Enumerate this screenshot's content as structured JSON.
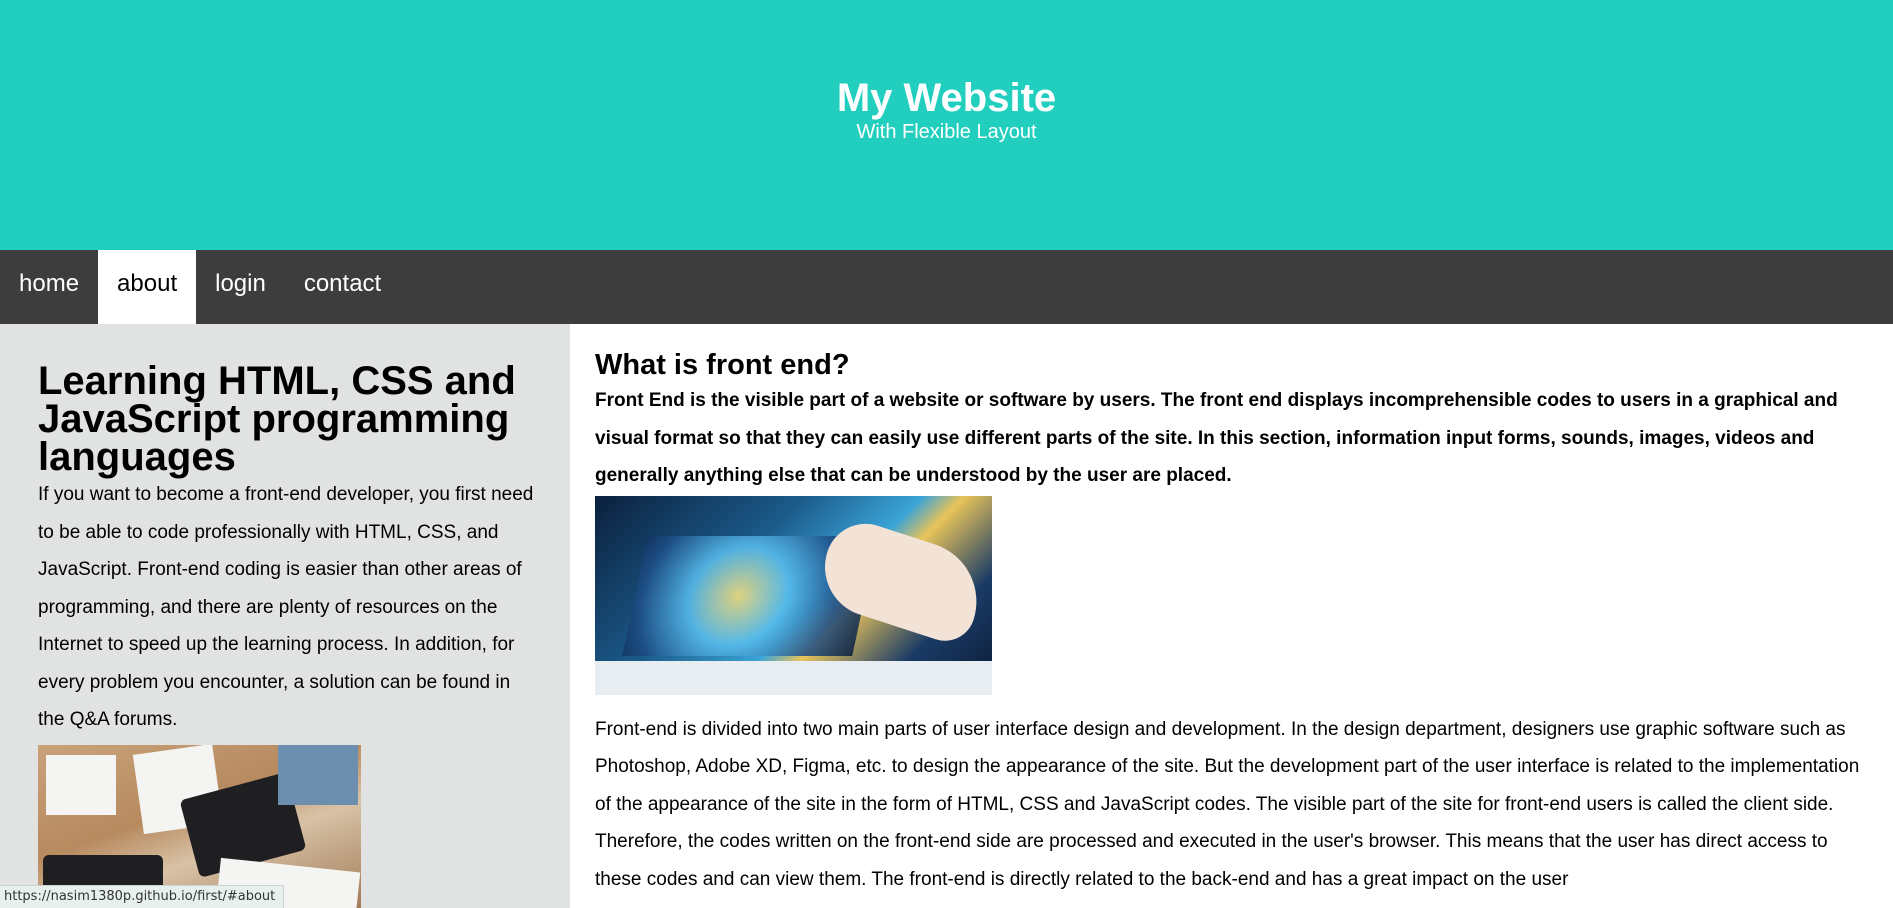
{
  "header": {
    "title": "My Website",
    "subtitle": "With Flexible Layout"
  },
  "nav": {
    "items": [
      {
        "label": "home",
        "active": false
      },
      {
        "label": "about",
        "active": true
      },
      {
        "label": "login",
        "active": false
      },
      {
        "label": "contact",
        "active": false
      }
    ]
  },
  "sidebar": {
    "heading": "Learning HTML, CSS and JavaScript programming languages",
    "text": "If you want to become a front-end developer, you first need to be able to code professionally with HTML, CSS, and JavaScript. Front-end coding is easier than other areas of programming, and there are plenty of resources on the Internet to speed up the learning process. In addition, for every problem you encounter, a solution can be found in the Q&A forums."
  },
  "main": {
    "heading": "What is front end?",
    "lead": "Front End is the visible part of a website or software by users. The front end displays incomprehensible codes to users in a graphical and visual format so that they can easily use different parts of the site. In this section, information input forms, sounds, images, videos and generally anything else that can be understood by the user are placed.",
    "body": "Front-end is divided into two main parts of user interface design and development. In the design department, designers use graphic software such as Photoshop, Adobe XD, Figma, etc. to design the appearance of the site. But the development part of the user interface is related to the implementation of the appearance of the site in the form of HTML, CSS and JavaScript codes. The visible part of the site for front-end users is called the client side. Therefore, the codes written on the front-end side are processed and executed in the user's browser. This means that the user has direct access to these codes and can view them. The front-end is directly related to the back-end and has a great impact on the user"
  },
  "status": {
    "url": "https://nasim1380p.github.io/first/#about"
  },
  "colors": {
    "header_bg": "#22cfbe",
    "nav_bg": "#3d3d3d",
    "sidebar_bg": "#e1e2e2"
  }
}
